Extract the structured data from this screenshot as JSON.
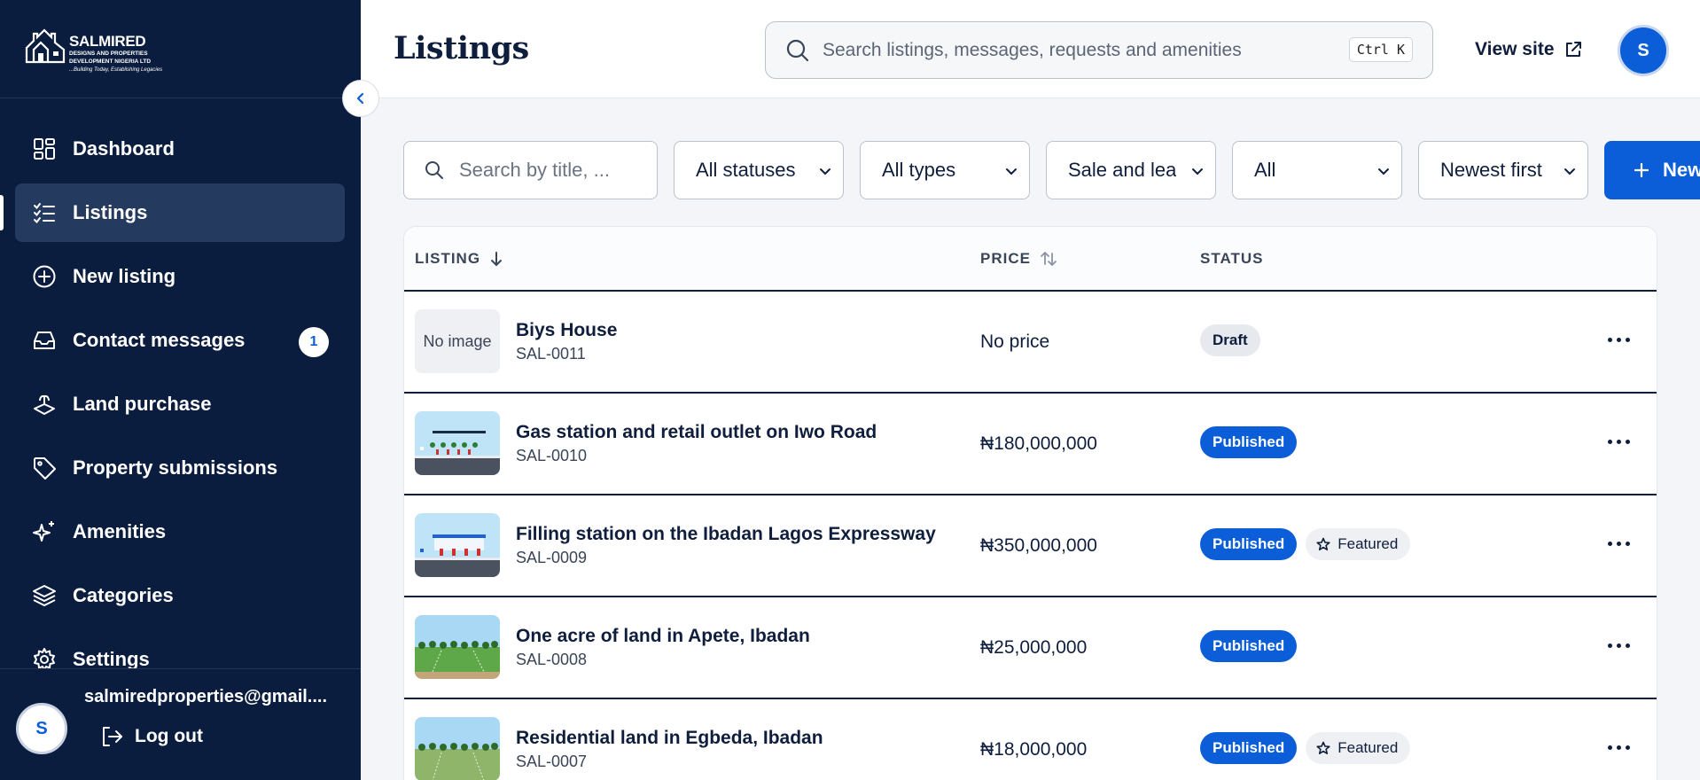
{
  "brand": {
    "name": "SALMIRED",
    "subtitle_line1": "DESIGNS AND PROPERTIES",
    "subtitle_line2": "DEVELOPMENT NIGERIA LTD",
    "tagline": "...Building Today, Establishing Legacies"
  },
  "sidebar": {
    "items": [
      {
        "label": "Dashboard",
        "icon": "dashboard-grid-icon"
      },
      {
        "label": "Listings",
        "icon": "list-checks-icon",
        "active": true
      },
      {
        "label": "New listing",
        "icon": "plus-circle-icon"
      },
      {
        "label": "Contact messages",
        "icon": "inbox-icon",
        "badge": "1"
      },
      {
        "label": "Land purchase",
        "icon": "land-icon"
      },
      {
        "label": "Property submissions",
        "icon": "tag-icon"
      },
      {
        "label": "Amenities",
        "icon": "sparkles-icon"
      },
      {
        "label": "Categories",
        "icon": "layers-icon"
      },
      {
        "label": "Settings",
        "icon": "gear-icon"
      }
    ],
    "user": {
      "avatar_initial": "S",
      "email": "salmiredproperties@gmail...."
    },
    "logout_label": "Log out"
  },
  "header": {
    "title": "Listings",
    "search_placeholder": "Search listings, messages, requests and amenities",
    "shortcut": "Ctrl K",
    "view_site_label": "View site",
    "avatar_initial": "S"
  },
  "filters": {
    "search_placeholder": "Search by title, ...",
    "status": "All statuses",
    "type": "All types",
    "mode": "Sale and lease",
    "featured": "All",
    "sort": "Newest first",
    "new_button": "New"
  },
  "table": {
    "columns": {
      "listing": "LISTING",
      "price": "PRICE",
      "status": "STATUS"
    },
    "rows": [
      {
        "title": "Biys House",
        "code": "SAL-0011",
        "price": "No price",
        "status": "Draft",
        "featured": false,
        "thumbnail": "none",
        "no_image_label": "No image"
      },
      {
        "title": "Gas station and retail outlet on Iwo Road",
        "code": "SAL-0010",
        "price": "₦180,000,000",
        "status": "Published",
        "featured": false,
        "thumbnail": "station"
      },
      {
        "title": "Filling station on the Ibadan Lagos Expressway",
        "code": "SAL-0009",
        "price": "₦350,000,000",
        "status": "Published",
        "featured": true,
        "featured_label": "Featured",
        "thumbnail": "station"
      },
      {
        "title": "One acre of land in Apete, Ibadan",
        "code": "SAL-0008",
        "price": "₦25,000,000",
        "status": "Published",
        "featured": false,
        "thumbnail": "land"
      },
      {
        "title": "Residential land in Egbeda, Ibadan",
        "code": "SAL-0007",
        "price": "₦18,000,000",
        "status": "Published",
        "featured": true,
        "featured_label": "Featured",
        "thumbnail": "land"
      }
    ]
  },
  "colors": {
    "sidebar": "#0b1d3f",
    "accent": "#0b5ed7",
    "text": "#0f1e3d"
  }
}
